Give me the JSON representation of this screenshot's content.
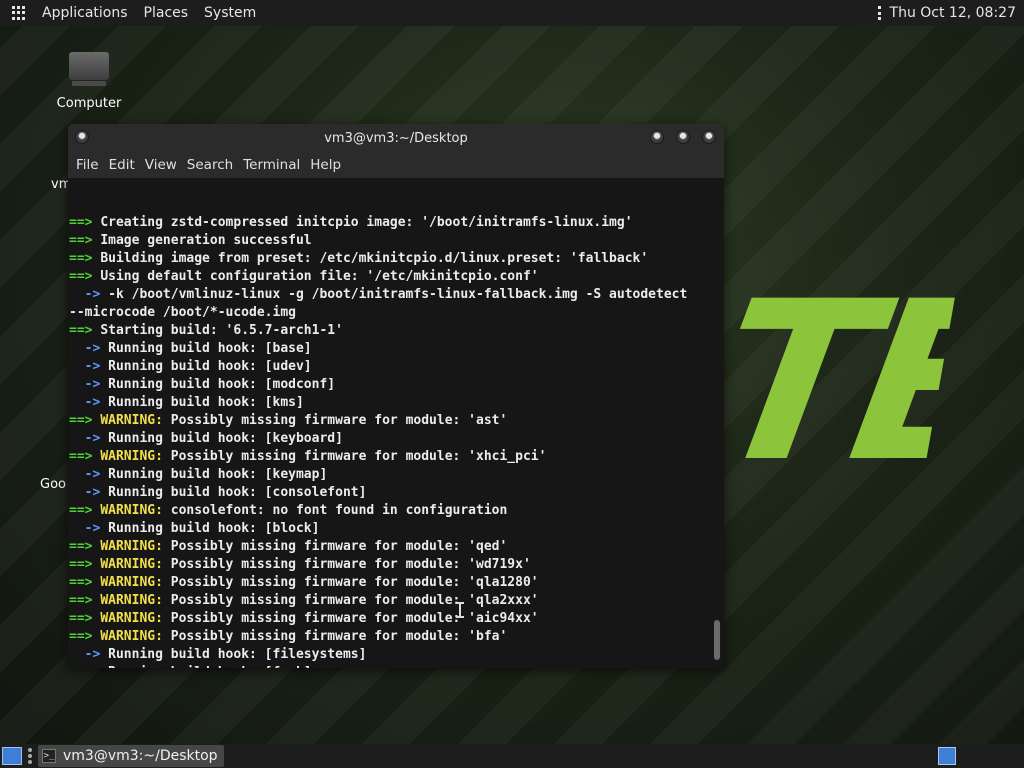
{
  "top_panel": {
    "menus": [
      "Applications",
      "Places",
      "System"
    ],
    "clock": "Thu Oct 12, 08:27"
  },
  "desktop": {
    "icons": [
      {
        "label": "Computer",
        "icon": "computer-icon"
      }
    ],
    "peek_labels": [
      "vm",
      "Goo"
    ],
    "logo_text": "TE",
    "logo_color": "#8cc43c"
  },
  "terminal": {
    "title": "vm3@vm3:~/Desktop",
    "menu": [
      "File",
      "Edit",
      "View",
      "Search",
      "Terminal",
      "Help"
    ],
    "colors": {
      "arrow_green": "#52d13b",
      "warning_yellow": "#f2e04a",
      "arrow_blue": "#5f97ff"
    },
    "lines": [
      {
        "kind": "main",
        "text": "Creating zstd-compressed initcpio image: '/boot/initramfs-linux.img'"
      },
      {
        "kind": "main",
        "text": "Image generation successful"
      },
      {
        "kind": "main",
        "text": "Building image from preset: /etc/mkinitcpio.d/linux.preset: 'fallback'"
      },
      {
        "kind": "main",
        "text": "Using default configuration file: '/etc/mkinitcpio.conf'"
      },
      {
        "kind": "sub",
        "text": "-k /boot/vmlinuz-linux -g /boot/initramfs-linux-fallback.img -S autodetect"
      },
      {
        "kind": "plain",
        "text": "--microcode /boot/*-ucode.img"
      },
      {
        "kind": "main",
        "text": "Starting build: '6.5.7-arch1-1'"
      },
      {
        "kind": "sub",
        "text": "Running build hook: [base]"
      },
      {
        "kind": "sub",
        "text": "Running build hook: [udev]"
      },
      {
        "kind": "sub",
        "text": "Running build hook: [modconf]"
      },
      {
        "kind": "sub",
        "text": "Running build hook: [kms]"
      },
      {
        "kind": "warn",
        "text": "Possibly missing firmware for module: 'ast'"
      },
      {
        "kind": "sub",
        "text": "Running build hook: [keyboard]"
      },
      {
        "kind": "warn",
        "text": "Possibly missing firmware for module: 'xhci_pci'"
      },
      {
        "kind": "sub",
        "text": "Running build hook: [keymap]"
      },
      {
        "kind": "sub",
        "text": "Running build hook: [consolefont]"
      },
      {
        "kind": "warn",
        "text": "consolefont: no font found in configuration"
      },
      {
        "kind": "sub",
        "text": "Running build hook: [block]"
      },
      {
        "kind": "warn",
        "text": "Possibly missing firmware for module: 'qed'"
      },
      {
        "kind": "warn",
        "text": "Possibly missing firmware for module: 'wd719x'"
      },
      {
        "kind": "warn",
        "text": "Possibly missing firmware for module: 'qla1280'"
      },
      {
        "kind": "warn",
        "text": "Possibly missing firmware for module: 'qla2xxx'"
      },
      {
        "kind": "warn",
        "text": "Possibly missing firmware for module: 'aic94xx'"
      },
      {
        "kind": "warn",
        "text": "Possibly missing firmware for module: 'bfa'"
      },
      {
        "kind": "sub",
        "text": "Running build hook: [filesystems]"
      },
      {
        "kind": "sub",
        "text": "Running build hook: [fsck]"
      }
    ],
    "prefixes": {
      "main": "==>",
      "sub": "->",
      "warn_label": "WARNING:"
    }
  },
  "bottom_panel": {
    "task_label": "vm3@vm3:~/Desktop",
    "task_icon_text": ">_"
  }
}
